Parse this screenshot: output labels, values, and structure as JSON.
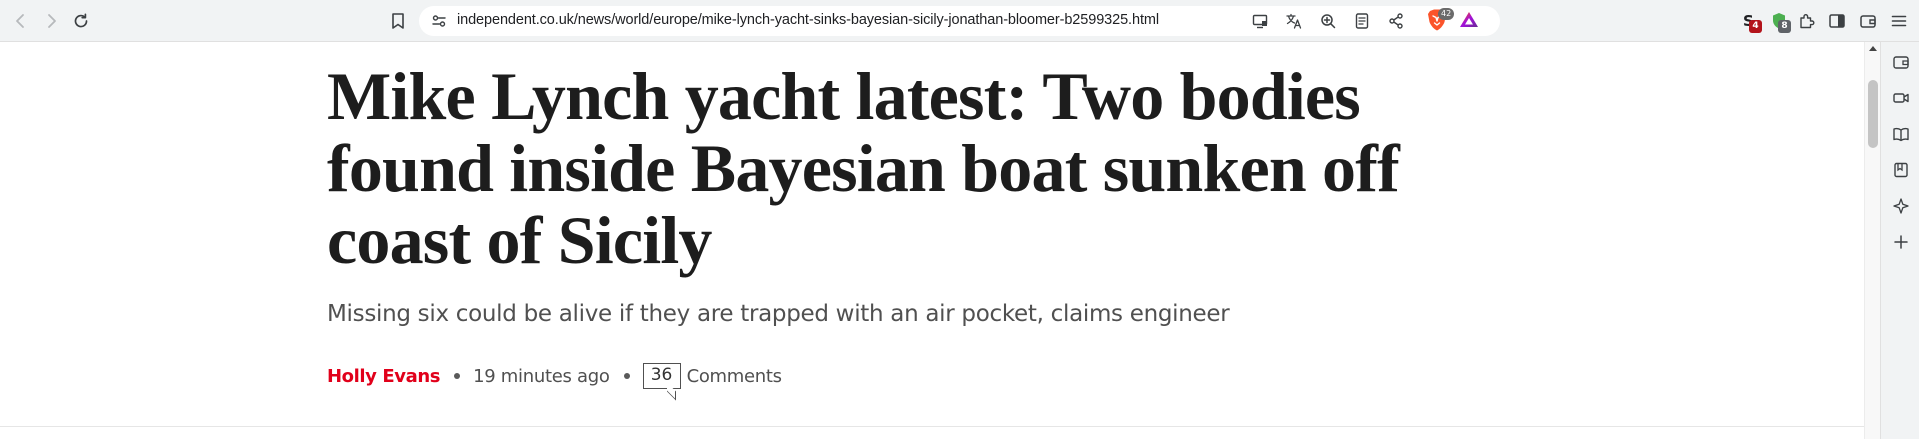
{
  "browser": {
    "url": "independent.co.uk/news/world/europe/mike-lynch-yacht-sinks-bayesian-sicily-jonathan-bloomer-b2599325.html",
    "toolbar_icons": [
      "back-icon",
      "forward-icon",
      "reload-icon",
      "bookmark-icon",
      "site-info-icon",
      "cast-icon",
      "translate-icon",
      "zoom-icon",
      "reader-mode-icon",
      "share-icon",
      "brave-shields-icon",
      "brave-rewards-icon"
    ],
    "shields_count": "42",
    "extensions": [
      {
        "name": "extension-s-icon",
        "badge": "4",
        "badge_color": "#b3131b"
      },
      {
        "name": "extension-shield-icon",
        "badge": "8",
        "badge_color": "#5f6368"
      }
    ],
    "sidebar_icons": [
      "wallet-icon",
      "video-call-icon",
      "reading-list-icon",
      "bookmarks-icon",
      "leo-ai-icon",
      "add-icon"
    ]
  },
  "article": {
    "headline": "Mike Lynch yacht latest: Two bodies found inside Bayesian boat sunken off coast of Sicily",
    "standfirst": "Missing six could be alive if they are trapped with an air pocket, claims engineer",
    "author": "Holly Evans",
    "published": "19 minutes ago",
    "comment_count": "36",
    "comments_label": "Comments"
  },
  "colors": {
    "author_red": "#e1001a",
    "headline": "#1d1d1d",
    "meta_text": "#505050",
    "toolbar_bg": "#f1f3f4"
  }
}
